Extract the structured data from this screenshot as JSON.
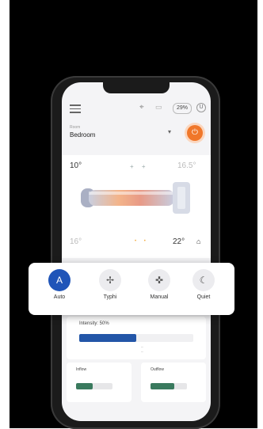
{
  "topbar": {
    "pill_text": "29%",
    "user_initial": "U"
  },
  "room": {
    "caption": "Room",
    "name": "Bedroom",
    "chevron": "▾",
    "power_symbol": "⏻"
  },
  "heater": {
    "temp_top_left": "10°",
    "temp_top_right": "16.5°",
    "temp_bottom_left": "16°",
    "temp_bottom_right": "22°",
    "fan_indicator": "+ +",
    "sun_indicator": "• •"
  },
  "modes": [
    {
      "label": "Auto",
      "symbol": "A",
      "icon": "auto-icon",
      "active": true
    },
    {
      "label": "Typhi",
      "symbol": "✢",
      "icon": "fan-icon",
      "active": false
    },
    {
      "label": "Manual",
      "symbol": "✜",
      "icon": "manual-icon",
      "active": false
    },
    {
      "label": "Quiet",
      "symbol": "☾",
      "icon": "moon-icon",
      "active": false
    }
  ],
  "intensity": {
    "label": "Intensity: 50%",
    "level": 0.5
  },
  "cards": [
    {
      "label": "Inflow",
      "level": 0.45
    },
    {
      "label": "Outflow",
      "level": 0.65
    }
  ],
  "colors": {
    "accent": "#2356a8",
    "power": "#f0772a",
    "slider": "#3a7a5e"
  }
}
